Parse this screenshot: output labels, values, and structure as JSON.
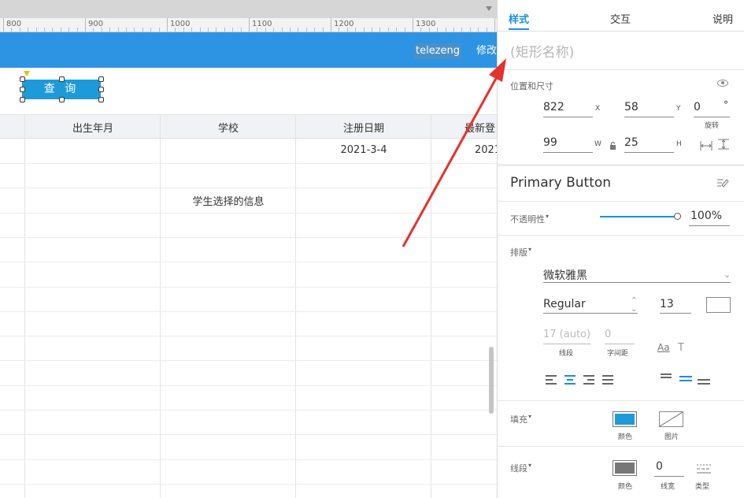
{
  "ruler": {
    "labels": [
      "800",
      "900",
      "1000",
      "1100",
      "1200",
      "1300"
    ]
  },
  "header": {
    "username": "telezeng",
    "modify_label": "修改"
  },
  "canvas": {
    "query_button_label": "查 询"
  },
  "table": {
    "columns": [
      "",
      "出生年月",
      "学校",
      "注册日期",
      "最新登"
    ],
    "rows": [
      [
        "",
        "",
        "",
        "2021-3-4",
        "2021"
      ],
      [
        "",
        "",
        "",
        "",
        ""
      ],
      [
        "",
        "",
        "学生选择的信息",
        "",
        ""
      ]
    ]
  },
  "panel": {
    "tabs": [
      {
        "label": "样式",
        "active": true
      },
      {
        "label": "交互",
        "active": false
      },
      {
        "label": "说明",
        "active": false
      }
    ],
    "name_placeholder": "(矩形名称)",
    "position_size": {
      "title": "位置和尺寸",
      "x": "822",
      "x_label": "X",
      "y": "58",
      "y_label": "Y",
      "rotation": "0",
      "rotation_unit": "°",
      "rotation_label": "旋转",
      "w": "99",
      "w_label": "W",
      "h": "25",
      "h_label": "H"
    },
    "style_name": "Primary Button",
    "opacity": {
      "label": "不透明性",
      "value": "100%",
      "level": 1.0
    },
    "typography": {
      "label": "排版",
      "font": "微软雅黑",
      "weight": "Regular",
      "size": "13",
      "line_height": "17 (auto)",
      "line_height_label": "线段",
      "letter_spacing": "0",
      "letter_spacing_label": "字间距",
      "aa_label": "Aa",
      "t_label": "T"
    },
    "fill": {
      "label": "填充",
      "color_label": "颜色",
      "image_label": "图片",
      "color": "#1e9ad9"
    },
    "stroke": {
      "label": "线段",
      "color_label": "颜色",
      "width": "0",
      "width_label": "线宽",
      "type_label": "类型",
      "color": "#777777"
    }
  },
  "colors": {
    "accent": "#1a8fe3",
    "header_bar": "#2d93e3",
    "annotation_arrow": "#e5322d"
  }
}
